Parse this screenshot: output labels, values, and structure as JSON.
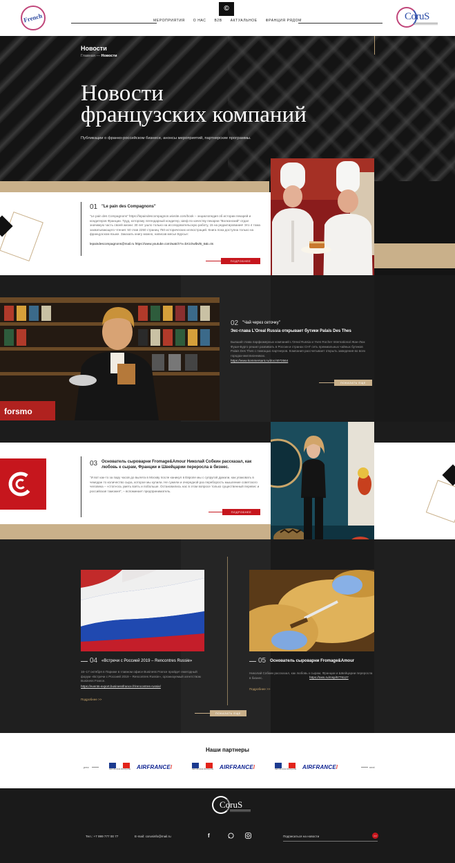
{
  "header": {
    "nav": [
      "МЕРОПРИЯТИЯ",
      "О НАС",
      "B2B",
      "АКТУАЛЬНОЕ",
      "ФРАНЦИЯ РЯДОМ"
    ],
    "logo_left_text": "French",
    "logo_right_text": "CoruS"
  },
  "hero": {
    "section_label": "Новости",
    "crumb_home": "Главная",
    "crumb_sep": "—",
    "crumb_current": "Новости",
    "title_line1": "Новости",
    "title_line2": "французских компаний",
    "subtitle": "Публикации о франко-российском бизнесе, анонсы мероприятий, партнерские программы."
  },
  "articles": [
    {
      "num": "01",
      "title": "\"Le pain des Compagnons\"",
      "text": "\"Le pain des Compagnons\" https://lepaindescompagnon.wixsite.com/book – энциклопедия об истории пекарей и кондитеров Франции. Труд, которому легендарный кондитер, Шеф по качеству пекарни \"Волконский\" отдал значимую часть своей жизни: 30 лет ушло только на исследовательскую работу, 15 на редактирование! Это 4 тома захватывающего чтения: 50 глав 2250 страниц 750 исторических иллюстраций. Книга пока доступна только на французском языке. Заказать книгу можно, написав месье Бурсье:",
      "link": "lepaindescompagnons@mail.ru https://www.youtube.com/watch?v=bX1Owlbvl6_6&t=4s",
      "button": "ПОДРОБНЕЕ"
    },
    {
      "num": "02",
      "title": "\"Чай через сеточку\"",
      "subtitle": "Экс-глава L'Oreal Russia открывает бутики Palais Des Thes",
      "text": "Бывший глава парфюмерных компаний L'Oreal Russia и Yves Rocher International Жан-Люк Фуше-Бурго решил развивать в России и странах СНГ сеть премиальных чайных бутиков Palais Des Thes с помощью партнеров. Компания рассчитывает открыть заведения во всех городах-миллионниках.",
      "link": "https://www.kommersant.ru/doc/4072564",
      "button": "ПОКАЗАТЬ ЕЩЕ"
    },
    {
      "num": "03",
      "title": "Основатель сыроварни Fromage&Amour Николай Собкин рассказал, как любовь к сырам, Франции и Швейцарии переросла в бизнес.",
      "text": "\"И вот как-то за пару часов до вылета в Москву после каникул в Европе мы с супругой думали, как упаковать в чемодан то количество сыра, которое мы купили. Не сумели и очередной раз переборость мышление советского человека – «стоп»ось уметь взять и побольше. Остановились нас в этом вопросе только существенный перевес и российская таможня\", – вспоминает предприниматель.",
      "button": "ПОДРОБНЕЕ"
    },
    {
      "num": "04",
      "title": "«Встречи с Россией 2019 – Rencontres Russie»",
      "text": "16–17 октября в Париже в главном офисе Business France пройдет ежегодный форум «Встречи с Россией 2019 – Rencontres Russie», организуемый агентством Business France.",
      "link": "https://events-export.businessfrance.fr/rencontres-russie/",
      "more": "Подробнее >>"
    },
    {
      "num": "05",
      "title": "Основатель сыроварни Fromage&Amour",
      "text": "Николай Собкин рассказал, как любовь к сырам, Франции и Швейцарии переросла в бизнес.",
      "link": "https://tass.ru/msp/6776127",
      "more": "Подробнее >>"
    }
  ],
  "show_more": "ПОКАЗАТЬ ЕЩЕ",
  "partners": {
    "title": "Наши партнеры",
    "prev": "prev",
    "next": "next",
    "items": [
      {
        "type": "flag",
        "caption": "RÉPUBLIQUE FRANÇAISE"
      },
      {
        "type": "airline",
        "label": "AIRFRANCE"
      },
      {
        "type": "flag",
        "caption": "RÉPUBLIQUE FRANÇAISE"
      },
      {
        "type": "airline",
        "label": "AIRFRANCE"
      },
      {
        "type": "flag",
        "caption": "RÉPUBLIQUE FRANÇAISE"
      },
      {
        "type": "airline",
        "label": "AIRFRANCE"
      }
    ]
  },
  "footer": {
    "logo_text": "CoruS",
    "phone": "Тел.: +7 999 777 00 77",
    "email": "E-mail: corusinfo@mail.ru",
    "social": [
      "facebook-icon",
      "whatsapp-icon",
      "instagram-icon"
    ],
    "subscribe": "Подписаться на новости",
    "subscribe_btn": ">>"
  },
  "colors": {
    "accent_red": "#c6161d",
    "gold": "#c9b08a",
    "dark": "#1c1c1c"
  }
}
